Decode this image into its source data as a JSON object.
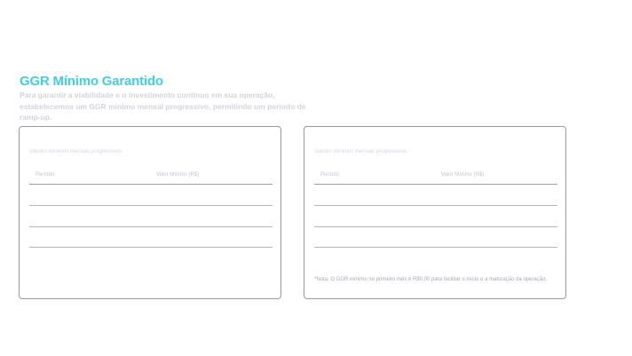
{
  "header": {
    "title": "GGR Mínimo Garantido",
    "subtitle": "Para garantir a viabilidade e o investimento contínuo em sua operação, estabelecemos um GGR mínimo mensal progressivo, permitindo um período de ramp-up."
  },
  "cards": [
    {
      "caption": "Valores mínimos mensais progressivos",
      "columns": [
        "Período",
        "Valor Mínimo (R$)"
      ],
      "rows": [],
      "note": ""
    },
    {
      "caption": "Valores mínimos mensais progressivos",
      "columns": [
        "Período",
        "Valor Mínimo (R$)"
      ],
      "rows": [],
      "note": "*Nota: O GGR mínimo no primeiro mês é R$0,00 para facilitar o início e a maturação da operação."
    }
  ],
  "colors": {
    "accent": "#3fd0de",
    "card_border": "#9a9a9a",
    "muted_text": "#d3d4de"
  }
}
